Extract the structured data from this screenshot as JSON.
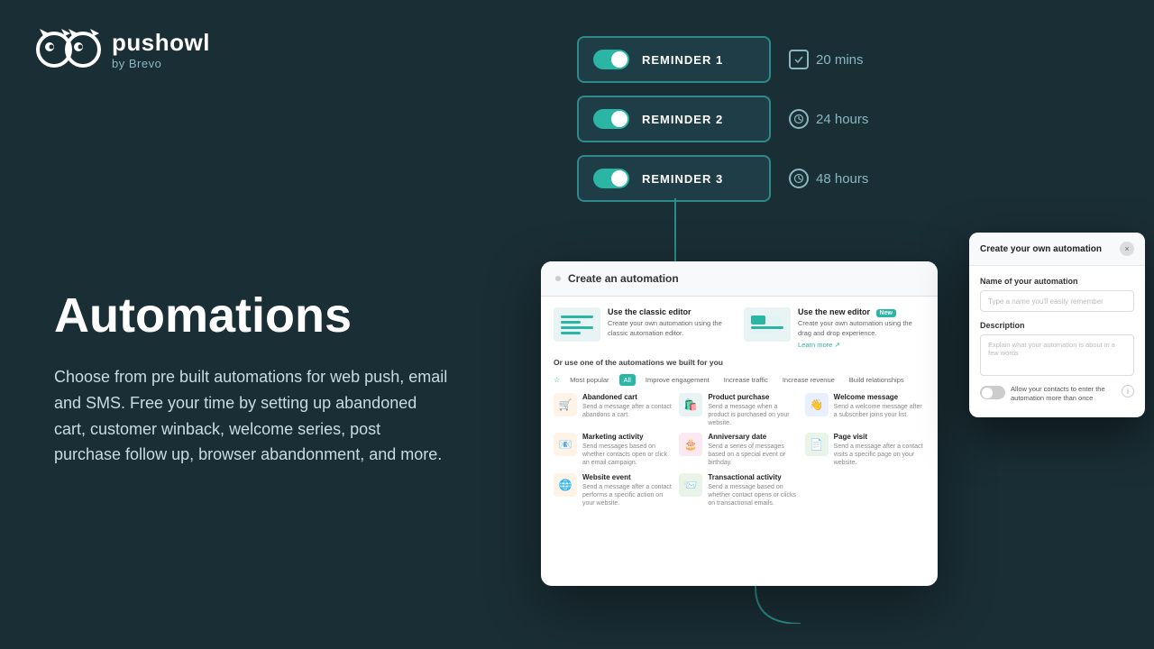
{
  "logo": {
    "brand": "pushowl",
    "tagline": "by Brevo"
  },
  "hero": {
    "title": "Automations",
    "description": "Choose from pre built automations for web push, email and SMS. Free your time by setting up abandoned cart, customer winback, welcome series, post purchase follow up, browser abandonment, and more."
  },
  "reminders": [
    {
      "label": "REMINDER 1",
      "time": "20 mins",
      "icon_type": "check"
    },
    {
      "label": "REMINDER 2",
      "time": "24 hours",
      "icon_type": "clock"
    },
    {
      "label": "REMINDER 3",
      "time": "48 hours",
      "icon_type": "clock"
    }
  ],
  "create_automation_modal": {
    "title": "Create an automation",
    "classic_editor": {
      "name": "Use the classic editor",
      "desc": "Create your own automation using the classic automation editor."
    },
    "new_editor": {
      "name": "Use the new editor",
      "badge": "New",
      "desc": "Create your own automation using the drag and drop experience.",
      "link": "Learn more"
    },
    "or_use_label": "Or use one of the automations we built for you",
    "filters": [
      "Most popular",
      "All",
      "Improve engagement",
      "Increase traffic",
      "Increase revenue",
      "Build relationships"
    ],
    "active_filter": "All",
    "automations": [
      {
        "name": "Abandoned cart",
        "desc": "Send a message after a contact abandons a cart.",
        "icon": "🛒",
        "type": "cart"
      },
      {
        "name": "Product purchase",
        "desc": "Send a message when a product is purchased on your website.",
        "icon": "🛍️",
        "type": "purchase"
      },
      {
        "name": "Welcome message",
        "desc": "Send a welcome message after a subscriber joins your list.",
        "icon": "👋",
        "type": "welcome"
      },
      {
        "name": "Marketing activity",
        "desc": "Send messages based on whether contacts open or click an email campaign.",
        "icon": "📧",
        "type": "marketing"
      },
      {
        "name": "Anniversary date",
        "desc": "Send a series of messages based on a special event or birthday.",
        "icon": "🎂",
        "type": "anniversary"
      },
      {
        "name": "Page visit",
        "desc": "Send a message after a contact visits a specific page on your website.",
        "icon": "📄",
        "type": "page"
      },
      {
        "name": "Website event",
        "desc": "Send a message after a contact performs a specific action on your website.",
        "icon": "🌐",
        "type": "website"
      },
      {
        "name": "Transactional activity",
        "desc": "Send a message based on whether contact opens or clicks on transactional emails.",
        "icon": "📨",
        "type": "transactional"
      }
    ]
  },
  "create_own_panel": {
    "title": "Create your own automation",
    "close_label": "×",
    "name_field": {
      "label": "Name of your automation",
      "placeholder": "Type a name you'll easily remember"
    },
    "description_field": {
      "label": "Description",
      "placeholder": "Explain what your automation is about in a few words"
    },
    "allow_toggle_text": "Allow your contacts to enter the automation more than once"
  },
  "colors": {
    "bg": "#1a2e35",
    "accent": "#2ab5a5",
    "border": "#2e8a8a"
  }
}
